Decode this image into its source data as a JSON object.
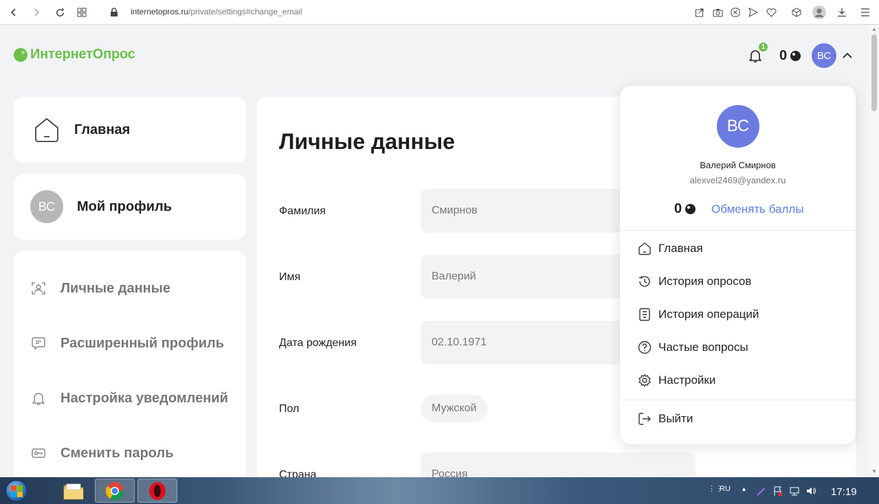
{
  "browser": {
    "url_host": "internetopros.ru",
    "url_path": "/private/settings#change_email"
  },
  "header": {
    "logo_text": "ИнтернетОпрос",
    "notification_count": "1",
    "points": "0",
    "avatar_initials": "ВС"
  },
  "sidebar": {
    "home_label": "Главная",
    "profile_initials": "ВС",
    "profile_label": "Мой профиль",
    "menu": [
      {
        "label": "Личные данные",
        "icon": "face-scan-icon"
      },
      {
        "label": "Расширенный профиль",
        "icon": "chat-icon"
      },
      {
        "label": "Настройка уведомлений",
        "icon": "bell-icon"
      },
      {
        "label": "Сменить пароль",
        "icon": "key-icon"
      }
    ]
  },
  "form": {
    "title": "Личные данные",
    "fields": [
      {
        "label": "Фамилия",
        "value": "Смирнов"
      },
      {
        "label": "Имя",
        "value": "Валерий"
      },
      {
        "label": "Дата рождения",
        "value": "02.10.1971"
      },
      {
        "label": "Пол",
        "value": "Мужской"
      },
      {
        "label": "Страна",
        "value": "Россия"
      }
    ]
  },
  "dropdown": {
    "initials": "ВС",
    "name": "Валерий Смирнов",
    "email": "alexvel2469@yandex.ru",
    "points": "0",
    "exchange_label": "Обменять баллы",
    "items": [
      {
        "label": "Главная",
        "icon": "home-icon"
      },
      {
        "label": "История опросов",
        "icon": "history-icon"
      },
      {
        "label": "История операций",
        "icon": "receipt-icon"
      },
      {
        "label": "Частые вопросы",
        "icon": "question-icon"
      },
      {
        "label": "Настройки",
        "icon": "gear-icon"
      }
    ],
    "logout_label": "Выйти"
  },
  "taskbar": {
    "language": "RU",
    "time": "17:19"
  },
  "colors": {
    "brand_green": "#6cc04a",
    "avatar_blue": "#6c7be0",
    "link_blue": "#5b7fe0",
    "page_bg": "#f2f3f5"
  }
}
